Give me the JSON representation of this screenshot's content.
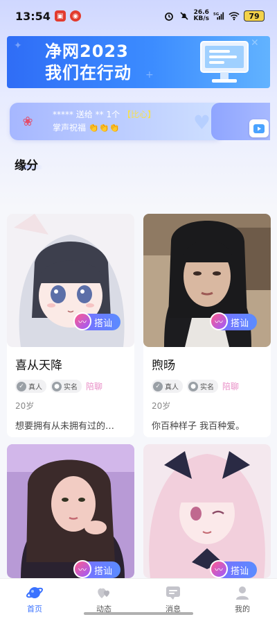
{
  "status_bar": {
    "time": "13:54",
    "net_speed_top": "26.6",
    "net_speed_bottom": "KB/s",
    "network": "5G",
    "battery": "79"
  },
  "banner": {
    "line1": "净网2023",
    "line2": "我们在行动"
  },
  "gift_notice": {
    "sender": "*****",
    "verb": "送给",
    "receiver": "**",
    "count": "1个",
    "gift": "【比心】",
    "line2": "掌声祝福",
    "hands": "👏👏👏"
  },
  "section": {
    "title": "缘分"
  },
  "cards": [
    {
      "name": "喜从天降",
      "badge_real": "真人",
      "badge_verified": "实名",
      "badge_chat": "陪聊",
      "age": "20岁",
      "bio": "想要拥有从未拥有过的…",
      "greet": "搭讪"
    },
    {
      "name": "煦旸",
      "badge_real": "真人",
      "badge_verified": "实名",
      "badge_chat": "陪聊",
      "age": "20岁",
      "bio": "你百种样子 我百种爱。",
      "greet": "搭讪"
    },
    {
      "greet": "搭讪"
    },
    {
      "greet": "搭讪"
    }
  ],
  "bottom_nav": [
    {
      "label": "首页",
      "icon": "planet-icon",
      "active": true
    },
    {
      "label": "动态",
      "icon": "hearts-icon",
      "active": false
    },
    {
      "label": "消息",
      "icon": "message-icon",
      "active": false
    },
    {
      "label": "我的",
      "icon": "person-icon",
      "active": false
    }
  ],
  "colors": {
    "accent": "#3a72ff",
    "greet_gradient_start": "#7e6bff",
    "greet_gradient_end": "#5a8cff",
    "banner_blue": "#2f6df6",
    "chat_badge": "#e98fc7"
  }
}
